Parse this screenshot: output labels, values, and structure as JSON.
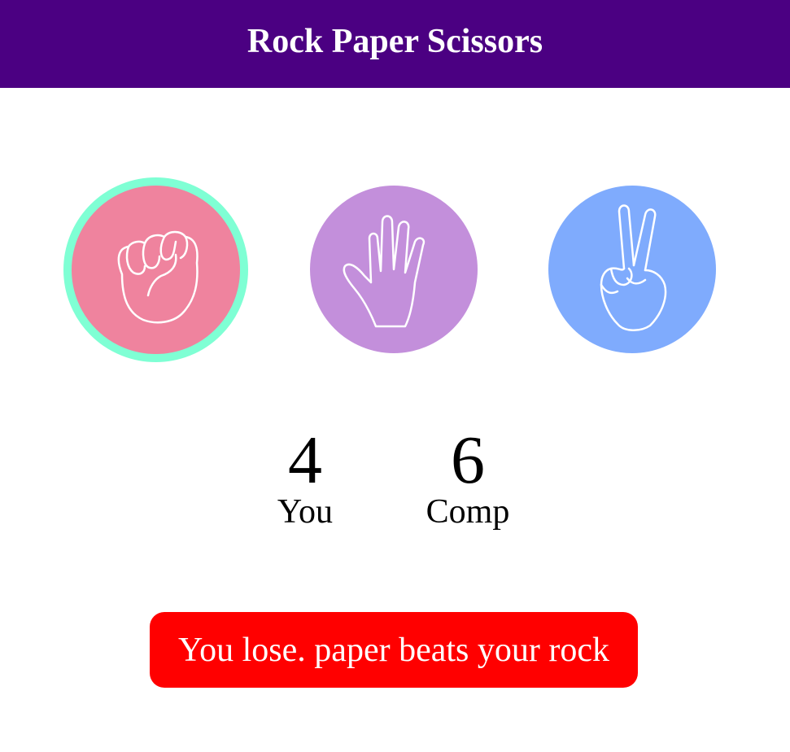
{
  "header": {
    "title": "Rock Paper Scissors"
  },
  "choices": [
    {
      "id": "rock",
      "icon": "fist-icon",
      "color": "#ef839e",
      "selected": true,
      "ring_color": "#7fffd4"
    },
    {
      "id": "paper",
      "icon": "open-hand-icon",
      "color": "#c38fdb",
      "selected": false
    },
    {
      "id": "scissors",
      "icon": "peace-hand-icon",
      "color": "#7fabfd",
      "selected": false
    }
  ],
  "scoreboard": {
    "user": {
      "score": "4",
      "label": "You"
    },
    "comp": {
      "score": "6",
      "label": "Comp"
    }
  },
  "result": {
    "message": "You lose. paper beats your rock",
    "color": "#ff0000"
  },
  "theme": {
    "header_bg": "#4b0082"
  }
}
